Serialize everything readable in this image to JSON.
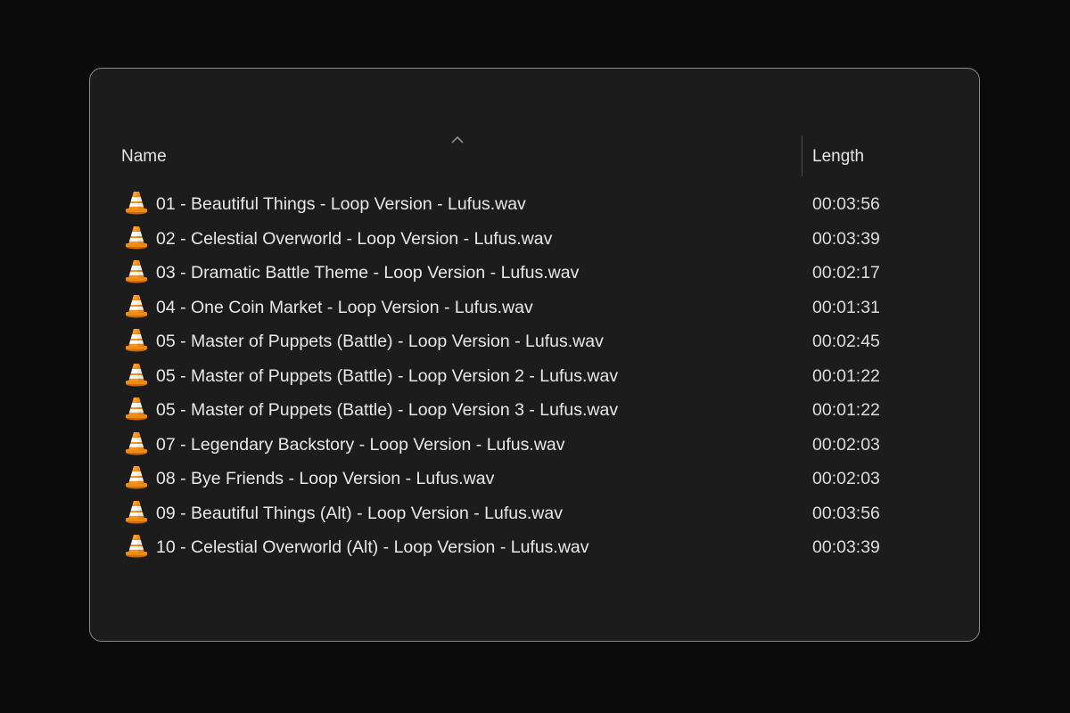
{
  "header": {
    "name_label": "Name",
    "length_label": "Length",
    "sort_icon": "chevron-up-icon"
  },
  "file_icon": "vlc-cone-icon",
  "colors": {
    "cone_orange": "#f08a12",
    "cone_stripe": "#ffffff",
    "background": "#1c1c1c"
  },
  "files": [
    {
      "name": "01 - Beautiful Things - Loop Version - Lufus.wav",
      "length": "00:03:56"
    },
    {
      "name": "02 - Celestial Overworld - Loop Version - Lufus.wav",
      "length": "00:03:39"
    },
    {
      "name": "03 - Dramatic Battle Theme - Loop Version - Lufus.wav",
      "length": "00:02:17"
    },
    {
      "name": "04 - One Coin Market - Loop Version - Lufus.wav",
      "length": "00:01:31"
    },
    {
      "name": "05 - Master of Puppets (Battle) - Loop Version - Lufus.wav",
      "length": "00:02:45"
    },
    {
      "name": "05 - Master of Puppets (Battle) - Loop Version 2 - Lufus.wav",
      "length": "00:01:22"
    },
    {
      "name": "05 - Master of Puppets (Battle) - Loop Version 3 - Lufus.wav",
      "length": "00:01:22"
    },
    {
      "name": "07 - Legendary Backstory - Loop Version - Lufus.wav",
      "length": "00:02:03"
    },
    {
      "name": "08 - Bye Friends - Loop Version - Lufus.wav",
      "length": "00:02:03"
    },
    {
      "name": "09 - Beautiful Things (Alt) - Loop Version - Lufus.wav",
      "length": "00:03:56"
    },
    {
      "name": "10 - Celestial Overworld (Alt) - Loop Version - Lufus.wav",
      "length": "00:03:39"
    }
  ]
}
